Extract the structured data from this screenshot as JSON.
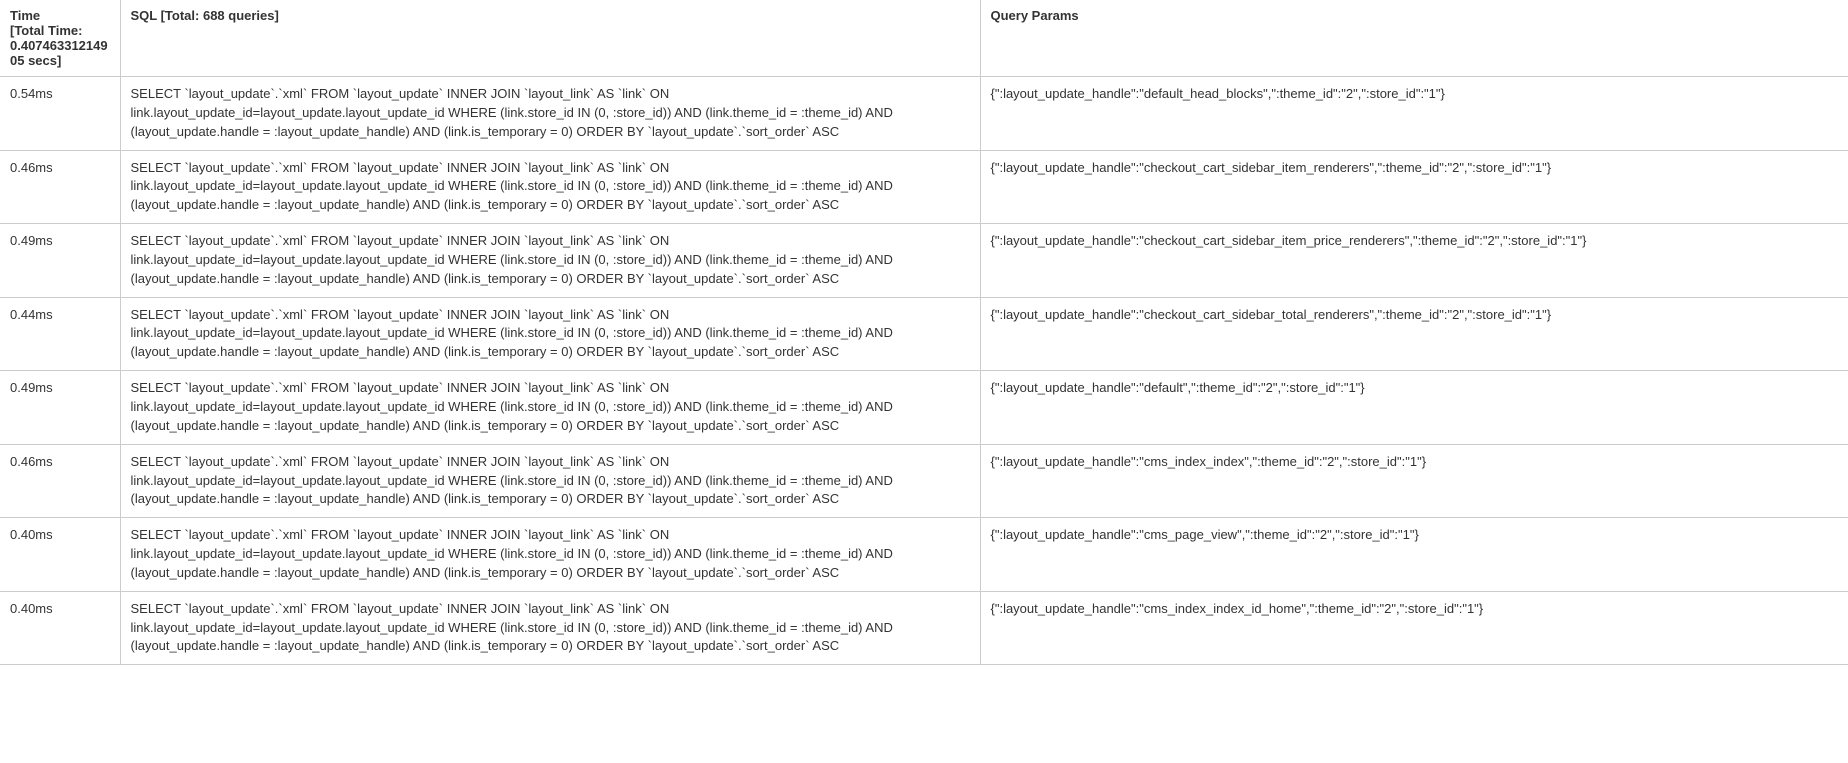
{
  "headers": {
    "time_label": "Time",
    "time_sub": "[Total Time: 0.40746331214905 secs]",
    "sql_label": "SQL [Total: 688 queries]",
    "params_label": "Query Params"
  },
  "rows": [
    {
      "time": "0.54ms",
      "sql": "SELECT `layout_update`.`xml` FROM `layout_update` INNER JOIN `layout_link` AS `link` ON link.layout_update_id=layout_update.layout_update_id WHERE (link.store_id IN (0, :store_id)) AND (link.theme_id = :theme_id) AND (layout_update.handle = :layout_update_handle) AND (link.is_temporary = 0) ORDER BY `layout_update`.`sort_order` ASC",
      "params": "{\":layout_update_handle\":\"default_head_blocks\",\":theme_id\":\"2\",\":store_id\":\"1\"}"
    },
    {
      "time": "0.46ms",
      "sql": "SELECT `layout_update`.`xml` FROM `layout_update` INNER JOIN `layout_link` AS `link` ON link.layout_update_id=layout_update.layout_update_id WHERE (link.store_id IN (0, :store_id)) AND (link.theme_id = :theme_id) AND (layout_update.handle = :layout_update_handle) AND (link.is_temporary = 0) ORDER BY `layout_update`.`sort_order` ASC",
      "params": "{\":layout_update_handle\":\"checkout_cart_sidebar_item_renderers\",\":theme_id\":\"2\",\":store_id\":\"1\"}"
    },
    {
      "time": "0.49ms",
      "sql": "SELECT `layout_update`.`xml` FROM `layout_update` INNER JOIN `layout_link` AS `link` ON link.layout_update_id=layout_update.layout_update_id WHERE (link.store_id IN (0, :store_id)) AND (link.theme_id = :theme_id) AND (layout_update.handle = :layout_update_handle) AND (link.is_temporary = 0) ORDER BY `layout_update`.`sort_order` ASC",
      "params": "{\":layout_update_handle\":\"checkout_cart_sidebar_item_price_renderers\",\":theme_id\":\"2\",\":store_id\":\"1\"}"
    },
    {
      "time": "0.44ms",
      "sql": "SELECT `layout_update`.`xml` FROM `layout_update` INNER JOIN `layout_link` AS `link` ON link.layout_update_id=layout_update.layout_update_id WHERE (link.store_id IN (0, :store_id)) AND (link.theme_id = :theme_id) AND (layout_update.handle = :layout_update_handle) AND (link.is_temporary = 0) ORDER BY `layout_update`.`sort_order` ASC",
      "params": "{\":layout_update_handle\":\"checkout_cart_sidebar_total_renderers\",\":theme_id\":\"2\",\":store_id\":\"1\"}"
    },
    {
      "time": "0.49ms",
      "sql": "SELECT `layout_update`.`xml` FROM `layout_update` INNER JOIN `layout_link` AS `link` ON link.layout_update_id=layout_update.layout_update_id WHERE (link.store_id IN (0, :store_id)) AND (link.theme_id = :theme_id) AND (layout_update.handle = :layout_update_handle) AND (link.is_temporary = 0) ORDER BY `layout_update`.`sort_order` ASC",
      "params": "{\":layout_update_handle\":\"default\",\":theme_id\":\"2\",\":store_id\":\"1\"}"
    },
    {
      "time": "0.46ms",
      "sql": "SELECT `layout_update`.`xml` FROM `layout_update` INNER JOIN `layout_link` AS `link` ON link.layout_update_id=layout_update.layout_update_id WHERE (link.store_id IN (0, :store_id)) AND (link.theme_id = :theme_id) AND (layout_update.handle = :layout_update_handle) AND (link.is_temporary = 0) ORDER BY `layout_update`.`sort_order` ASC",
      "params": "{\":layout_update_handle\":\"cms_index_index\",\":theme_id\":\"2\",\":store_id\":\"1\"}"
    },
    {
      "time": "0.40ms",
      "sql": "SELECT `layout_update`.`xml` FROM `layout_update` INNER JOIN `layout_link` AS `link` ON link.layout_update_id=layout_update.layout_update_id WHERE (link.store_id IN (0, :store_id)) AND (link.theme_id = :theme_id) AND (layout_update.handle = :layout_update_handle) AND (link.is_temporary = 0) ORDER BY `layout_update`.`sort_order` ASC",
      "params": "{\":layout_update_handle\":\"cms_page_view\",\":theme_id\":\"2\",\":store_id\":\"1\"}"
    },
    {
      "time": "0.40ms",
      "sql": "SELECT `layout_update`.`xml` FROM `layout_update` INNER JOIN `layout_link` AS `link` ON link.layout_update_id=layout_update.layout_update_id WHERE (link.store_id IN (0, :store_id)) AND (link.theme_id = :theme_id) AND (layout_update.handle = :layout_update_handle) AND (link.is_temporary = 0) ORDER BY `layout_update`.`sort_order` ASC",
      "params": "{\":layout_update_handle\":\"cms_index_index_id_home\",\":theme_id\":\"2\",\":store_id\":\"1\"}"
    }
  ]
}
